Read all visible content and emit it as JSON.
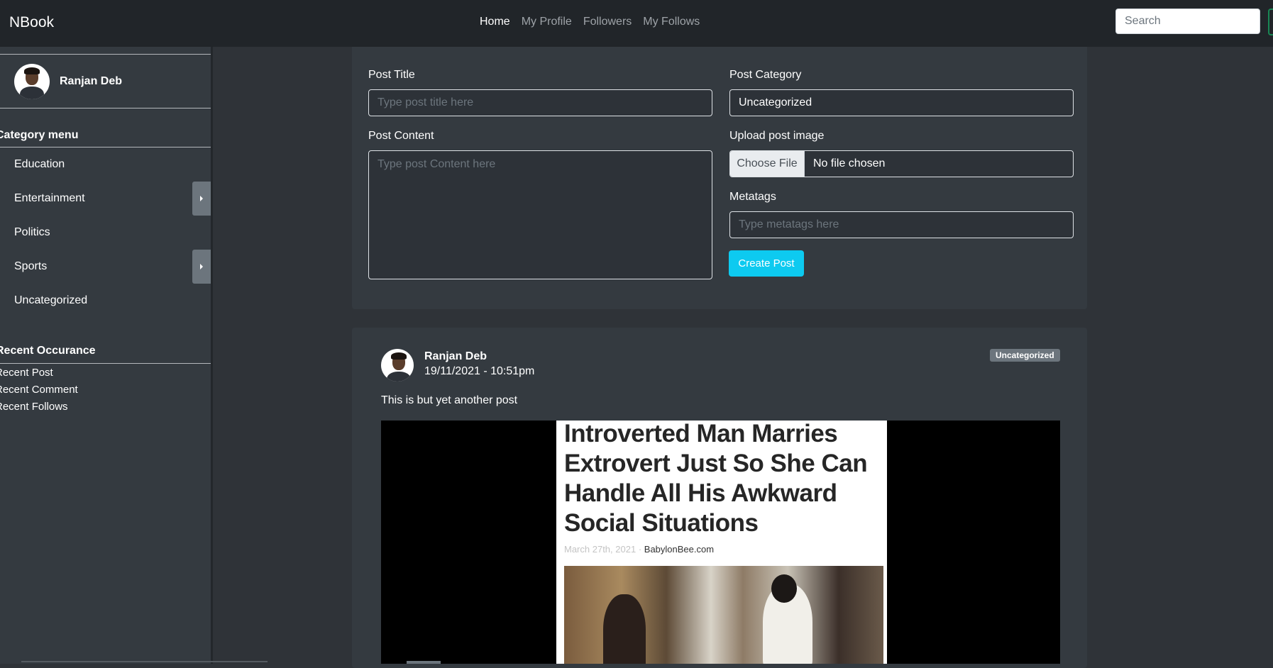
{
  "navbar": {
    "brand": "NBook",
    "links": [
      {
        "label": "Home",
        "active": true
      },
      {
        "label": "My Profile"
      },
      {
        "label": "Followers"
      },
      {
        "label": "My Follows"
      }
    ],
    "search_placeholder": "Search"
  },
  "sidebar": {
    "user_name": "Ranjan Deb",
    "category_title": "Category menu",
    "categories": [
      {
        "label": "Education",
        "has_submenu": false
      },
      {
        "label": "Entertainment",
        "has_submenu": true
      },
      {
        "label": "Politics",
        "has_submenu": false
      },
      {
        "label": "Sports",
        "has_submenu": true
      },
      {
        "label": "Uncategorized",
        "has_submenu": false
      }
    ],
    "recent_title": "Recent Occurance",
    "recent_items": [
      "Recent Post",
      "Recent Comment",
      "Recent Follows"
    ]
  },
  "form": {
    "title_label": "Post Title",
    "title_placeholder": "Type post title here",
    "category_label": "Post Category",
    "category_value": "Uncategorized",
    "content_label": "Post Content",
    "content_placeholder": "Type post Content here",
    "image_label": "Upload post image",
    "file_button": "Choose File",
    "file_status": "No file chosen",
    "metatags_label": "Metatags",
    "metatags_placeholder": "Type metatags here",
    "submit_label": "Create Post"
  },
  "post": {
    "author": "Ranjan Deb",
    "date": "19/11/2021 - 10:51pm",
    "category_badge": "Uncategorized",
    "text": "This is but yet another post",
    "image": {
      "headline": "Introverted Man Marries Extrovert Just So She Can Handle All His Awkward Social Situations",
      "date": "March 27th, 2021",
      "separator": "·",
      "site": "BabylonBee.com"
    }
  },
  "colors": {
    "navbar_bg": "#212529",
    "page_bg": "#2f3338",
    "card_bg": "#343a40",
    "button_info": "#0dcaf0",
    "badge_bg": "#6c757d"
  }
}
